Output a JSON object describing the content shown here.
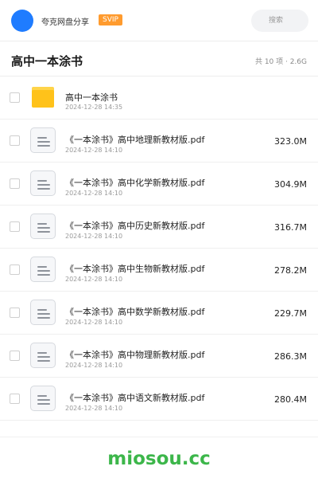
{
  "header": {
    "brand": "夸克网盘分享",
    "badge": "SVIP",
    "search_placeholder": "搜索"
  },
  "folder": {
    "title": "高中一本涂书",
    "meta": "共 10 项 · 2.6G"
  },
  "items": [
    {
      "type": "folder",
      "name": "高中一本涂书",
      "date": "2024-12-28 14:35",
      "size": ""
    },
    {
      "type": "file",
      "name": "《一本涂书》高中地理新教材版.pdf",
      "date": "2024-12-28 14:10",
      "size": "323.0M"
    },
    {
      "type": "file",
      "name": "《一本涂书》高中化学新教材版.pdf",
      "date": "2024-12-28 14:10",
      "size": "304.9M"
    },
    {
      "type": "file",
      "name": "《一本涂书》高中历史新教材版.pdf",
      "date": "2024-12-28 14:10",
      "size": "316.7M"
    },
    {
      "type": "file",
      "name": "《一本涂书》高中生物新教材版.pdf",
      "date": "2024-12-28 14:10",
      "size": "278.2M"
    },
    {
      "type": "file",
      "name": "《一本涂书》高中数学新教材版.pdf",
      "date": "2024-12-28 14:10",
      "size": "229.7M"
    },
    {
      "type": "file",
      "name": "《一本涂书》高中物理新教材版.pdf",
      "date": "2024-12-28 14:10",
      "size": "286.3M"
    },
    {
      "type": "file",
      "name": "《一本涂书》高中语文新教材版.pdf",
      "date": "2024-12-28 14:10",
      "size": "280.4M"
    }
  ],
  "watermark": "miosou.cc",
  "colors": {
    "accent": "#1f7cff",
    "badge": "#ff9b2e",
    "folder": "#ffc21a",
    "watermark": "#3cb64a"
  }
}
